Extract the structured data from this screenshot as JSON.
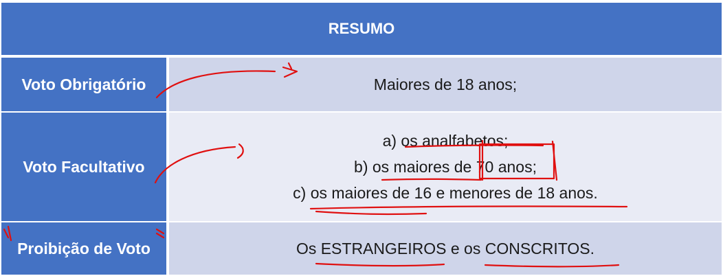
{
  "header": {
    "title": "RESUMO"
  },
  "rows": [
    {
      "label": "Voto Obrigatório",
      "values": [
        "Maiores de 18 anos;"
      ]
    },
    {
      "label": "Voto Facultativo",
      "values": [
        "a) os analfabetos;",
        "b) os maiores de 70 anos;",
        "c) os maiores de 16 e menores de 18 anos."
      ]
    },
    {
      "label": "Proibição de Voto",
      "values": [
        "Os ESTRANGEIROS e os CONSCRITOS."
      ]
    }
  ],
  "colors": {
    "header_bg": "#4472c4",
    "row_band_dark": "#cfd5ea",
    "row_band_light": "#e9ebf5",
    "annotation_ink": "#e01010"
  }
}
